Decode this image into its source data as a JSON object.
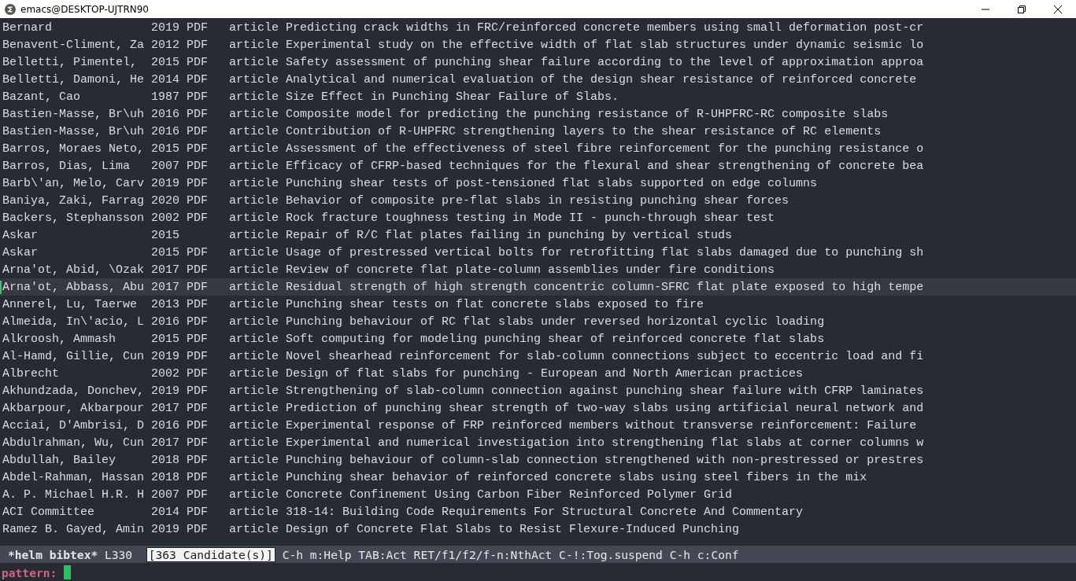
{
  "window": {
    "title": "emacs@DESKTOP-UJTRN90"
  },
  "rows": [
    {
      "author": "Bernard",
      "year": "2019",
      "pdf": "PDF",
      "type": "article",
      "title": "Predicting crack widths in FRC/reinforced concrete members using small deformation post-cr",
      "selected": false
    },
    {
      "author": "Benavent-Climent, Za",
      "year": "2012",
      "pdf": "PDF",
      "type": "article",
      "title": "Experimental study on the effective width of flat slab structures under dynamic seismic lo",
      "selected": false
    },
    {
      "author": "Belletti, Pimentel,",
      "year": "2015",
      "pdf": "PDF",
      "type": "article",
      "title": "Safety assessment of punching shear failure according to the level of approximation approa",
      "selected": false
    },
    {
      "author": "Belletti, Damoni, He",
      "year": "2014",
      "pdf": "PDF",
      "type": "article",
      "title": "Analytical and numerical evaluation of the design shear resistance of reinforced concrete",
      "selected": false
    },
    {
      "author": "Bazant, Cao",
      "year": "1987",
      "pdf": "PDF",
      "type": "article",
      "title": "Size Effect in Punching Shear Failure of Slabs.",
      "selected": false
    },
    {
      "author": "Bastien-Masse, Br\\uh",
      "year": "2016",
      "pdf": "PDF",
      "type": "article",
      "title": "Composite model for predicting the punching resistance of R-UHPFRC-RC composite slabs",
      "selected": false
    },
    {
      "author": "Bastien-Masse, Br\\uh",
      "year": "2016",
      "pdf": "PDF",
      "type": "article",
      "title": "Contribution of R-UHPFRC strengthening layers to the shear resistance of RC elements",
      "selected": false
    },
    {
      "author": "Barros, Moraes Neto,",
      "year": "2015",
      "pdf": "PDF",
      "type": "article",
      "title": "Assessment of the effectiveness of steel fibre reinforcement for the punching resistance o",
      "selected": false
    },
    {
      "author": "Barros, Dias, Lima",
      "year": "2007",
      "pdf": "PDF",
      "type": "article",
      "title": "Efficacy of CFRP-based techniques for the flexural and shear strengthening of concrete bea",
      "selected": false
    },
    {
      "author": "Barb\\'an, Melo, Carv",
      "year": "2019",
      "pdf": "PDF",
      "type": "article",
      "title": "Punching shear tests of post-tensioned flat slabs supported on edge columns",
      "selected": false
    },
    {
      "author": "Baniya, Zaki, Farrag",
      "year": "2020",
      "pdf": "PDF",
      "type": "article",
      "title": "Behavior of composite pre-flat slabs in resisting punching shear forces",
      "selected": false
    },
    {
      "author": "Backers, Stephansson",
      "year": "2002",
      "pdf": "PDF",
      "type": "article",
      "title": "Rock fracture toughness testing in Mode II - punch-through shear test",
      "selected": false
    },
    {
      "author": "Askar",
      "year": "2015",
      "type": "article",
      "title": "Repair of R/C flat plates failing in punching by vertical studs",
      "selected": false
    },
    {
      "author": "Askar",
      "year": "2015",
      "pdf": "PDF",
      "type": "article",
      "title": "Usage of prestressed vertical bolts for retrofitting flat slabs damaged due to punching sh",
      "selected": false
    },
    {
      "author": "Arna'ot, Abid, \\Ozak",
      "year": "2017",
      "pdf": "PDF",
      "type": "article",
      "title": "Review of concrete flat plate-column assemblies under fire conditions",
      "selected": false
    },
    {
      "author": "Arna'ot, Abbass, Abu",
      "year": "2017",
      "pdf": "PDF",
      "type": "article",
      "title": "Residual strength of high strength concentric column-SFRC flat plate exposed to high tempe",
      "selected": true
    },
    {
      "author": "Annerel, Lu, Taerwe",
      "year": "2013",
      "pdf": "PDF",
      "type": "article",
      "title": "Punching shear tests on flat concrete slabs exposed to fire",
      "selected": false
    },
    {
      "author": "Almeida, In\\'acio, L",
      "year": "2016",
      "pdf": "PDF",
      "type": "article",
      "title": "Punching behaviour of RC flat slabs under reversed horizontal cyclic loading",
      "selected": false
    },
    {
      "author": "Alkroosh, Ammash",
      "year": "2015",
      "pdf": "PDF",
      "type": "article",
      "title": "Soft computing for modeling punching shear of reinforced concrete flat slabs",
      "selected": false
    },
    {
      "author": "Al-Hamd, Gillie, Cun",
      "year": "2019",
      "pdf": "PDF",
      "type": "article",
      "title": "Novel shearhead reinforcement for slab-column connections subject to eccentric load and fi",
      "selected": false
    },
    {
      "author": "Albrecht",
      "year": "2002",
      "pdf": "PDF",
      "type": "article",
      "title": "Design of flat slabs for punching - European and North American practices",
      "selected": false
    },
    {
      "author": "Akhundzada, Donchev,",
      "year": "2019",
      "pdf": "PDF",
      "type": "article",
      "title": "Strengthening of slab-column connection against punching shear failure with CFRP laminates",
      "selected": false
    },
    {
      "author": "Akbarpour, Akbarpour",
      "year": "2017",
      "pdf": "PDF",
      "type": "article",
      "title": "Prediction of punching shear strength of two-way slabs using artificial neural network and",
      "selected": false
    },
    {
      "author": "Acciai, D'Ambrisi, D",
      "year": "2016",
      "pdf": "PDF",
      "type": "article",
      "title": "Experimental response of FRP reinforced members without transverse reinforcement: Failure",
      "selected": false
    },
    {
      "author": "Abdulrahman, Wu, Cun",
      "year": "2017",
      "pdf": "PDF",
      "type": "article",
      "title": "Experimental and numerical investigation into strengthening flat slabs at corner columns w",
      "selected": false
    },
    {
      "author": "Abdullah, Bailey",
      "year": "2018",
      "pdf": "PDF",
      "type": "article",
      "title": "Punching behaviour of column-slab connection strengthened with non-prestressed or prestres",
      "selected": false
    },
    {
      "author": "Abdel-Rahman, Hassan",
      "year": "2018",
      "pdf": "PDF",
      "type": "article",
      "title": "Punching shear behavior of reinforced concrete slabs using steel fibers in the mix",
      "selected": false
    },
    {
      "author": "A. P. Michael H.R. H",
      "year": "2007",
      "pdf": "PDF",
      "type": "article",
      "title": "Concrete Confinement Using Carbon Fiber Reinforced Polymer Grid",
      "selected": false
    },
    {
      "author": "ACI Committee",
      "year": "2014",
      "pdf": "PDF",
      "type": "article",
      "title": "318-14: Building Code Requirements For Structural Concrete And Commentary",
      "selected": false
    },
    {
      "author": "Ramez B. Gayed, Amin",
      "year": "2019",
      "pdf": "PDF",
      "type": "article",
      "title": "Design of Concrete Flat Slabs to Resist Flexure-Induced Punching",
      "selected": false
    }
  ],
  "mode_line": {
    "buffer": "*helm bibtex*",
    "line": "L330",
    "candidates": "[363 Candidate(s)]",
    "help": "C-h m:Help TAB:Act RET/f1/f2/f-n:NthAct C-!:Tog.suspend C-h c:Conf"
  },
  "minibuffer": {
    "prompt": "pattern:"
  }
}
